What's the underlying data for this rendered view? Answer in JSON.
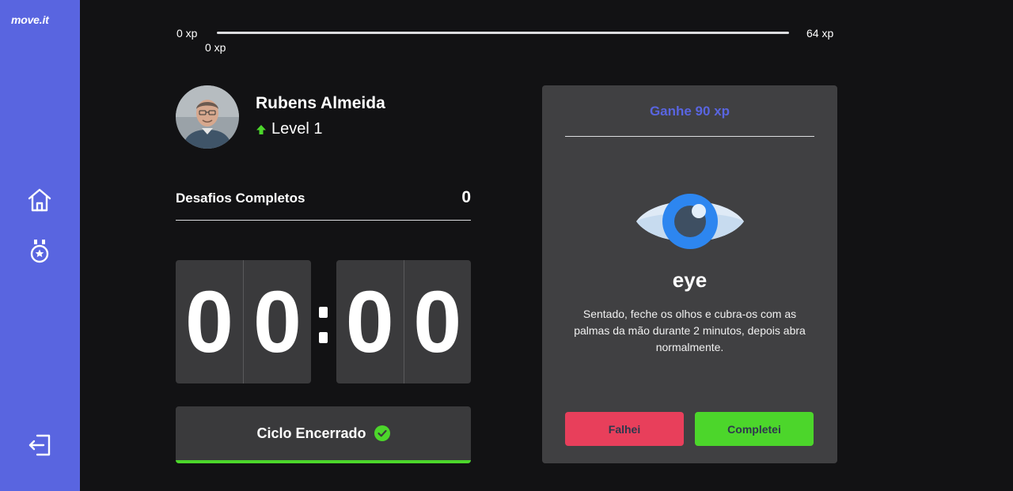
{
  "app": {
    "logo_text": "move.it"
  },
  "sidebar": {
    "items": [
      {
        "icon": "home-icon"
      },
      {
        "icon": "award-icon"
      }
    ],
    "logout_icon": "logout-icon"
  },
  "xp_bar": {
    "start_label": "0 xp",
    "end_label": "64 xp",
    "current_label": "0 xp",
    "progress_fraction": 0
  },
  "profile": {
    "name": "Rubens Almeida",
    "level_label": "Level 1"
  },
  "challenges": {
    "label": "Desafios Completos",
    "count": "0"
  },
  "countdown": {
    "minute_left": "0",
    "minute_right": "0",
    "second_left": "0",
    "second_right": "0"
  },
  "cycle_button": {
    "label": "Ciclo Encerrado",
    "progress_fraction": 1
  },
  "challenge_card": {
    "header": "Ganhe 90 xp",
    "icon": "eye-icon",
    "title": "eye",
    "description": "Sentado, feche os olhos e cubra-os com as palmas da mão durante 2 minutos, depois abra normalmente.",
    "fail_label": "Falhei",
    "success_label": "Completei"
  },
  "colors": {
    "sidebar": "#5965e0",
    "accent_blue": "#5965e0",
    "success": "#4cd62b",
    "fail": "#e83f5b",
    "background": "#121214",
    "panel": "#404042"
  }
}
